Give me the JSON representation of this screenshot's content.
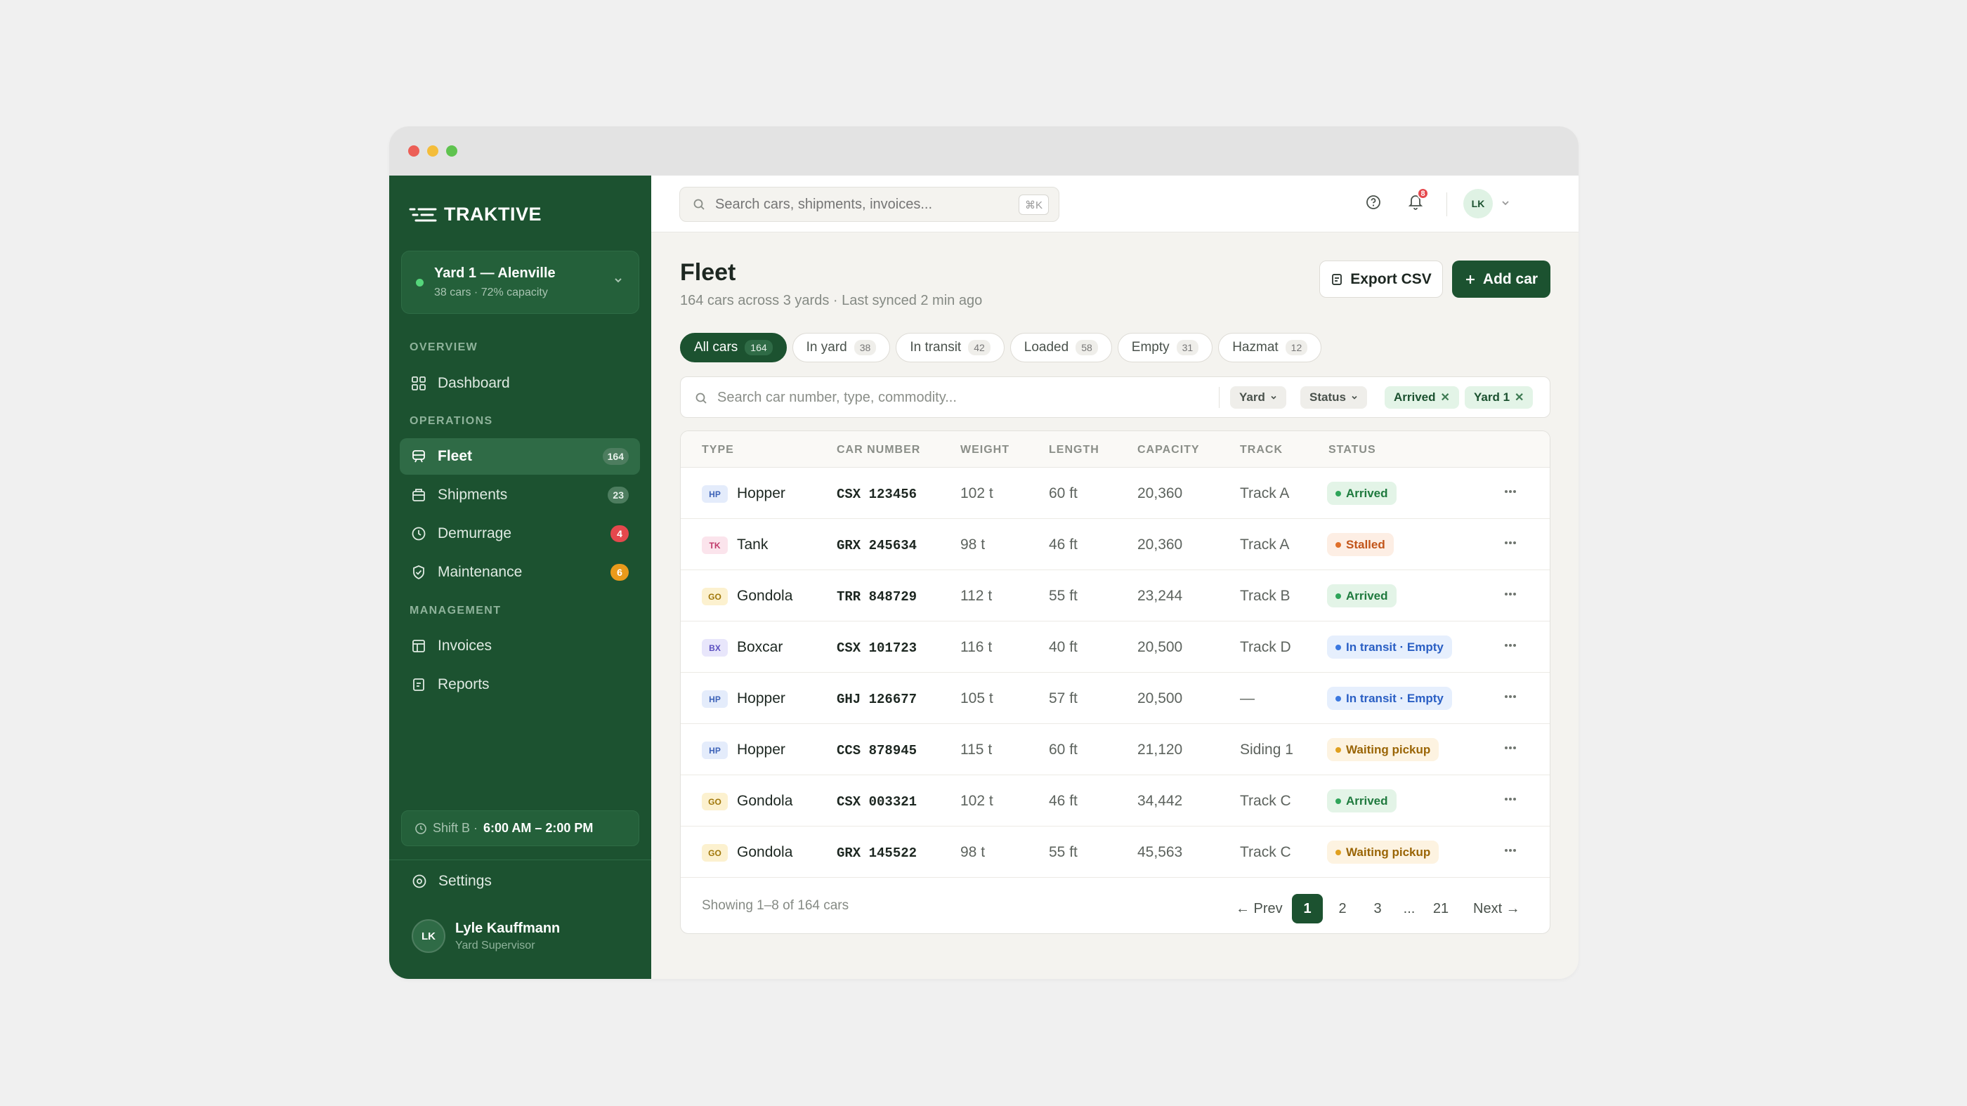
{
  "app": {
    "name": "TRAKTIVE"
  },
  "yard": {
    "name": "Yard 1 — Alenville",
    "subtitle": "38 cars · 72% capacity"
  },
  "sidebar": {
    "sections": {
      "overview": "OVERVIEW",
      "operations": "OPERATIONS",
      "management": "MANAGEMENT"
    },
    "items": [
      {
        "label": "Dashboard",
        "icon": "grid-icon"
      },
      {
        "label": "Fleet",
        "icon": "train-icon",
        "count": "164"
      },
      {
        "label": "Shipments",
        "icon": "box-icon",
        "count": "23"
      },
      {
        "label": "Demurrage",
        "icon": "clock-icon",
        "count": "4"
      },
      {
        "label": "Maintenance",
        "icon": "check-shield-icon",
        "count": "6"
      },
      {
        "label": "Invoices",
        "icon": "invoice-icon"
      },
      {
        "label": "Reports",
        "icon": "report-icon"
      }
    ],
    "shift": {
      "label": "Shift B ·",
      "time": "6:00 AM – 2:00 PM"
    },
    "settings": "Settings",
    "user": {
      "initials": "LK",
      "name": "Lyle Kauffmann",
      "role": "Yard Supervisor"
    }
  },
  "topbar": {
    "search_placeholder": "Search cars, shipments, invoices...",
    "shortcut": "⌘K",
    "notifications": "8",
    "avatar": "LK"
  },
  "page": {
    "title": "Fleet",
    "subtitle": "164 cars across 3 yards · Last synced 2 min ago",
    "export_label": "Export CSV",
    "add_label": "Add car"
  },
  "tabs": [
    {
      "label": "All cars",
      "count": "164"
    },
    {
      "label": "In yard",
      "count": "38"
    },
    {
      "label": "In transit",
      "count": "42"
    },
    {
      "label": "Loaded",
      "count": "58"
    },
    {
      "label": "Empty",
      "count": "31"
    },
    {
      "label": "Hazmat",
      "count": "12"
    }
  ],
  "filters": {
    "search_placeholder": "Search car number, type, commodity...",
    "yard": "Yard",
    "status": "Status",
    "active": [
      "Arrived",
      "Yard 1"
    ]
  },
  "table": {
    "columns": [
      "TYPE",
      "CAR NUMBER",
      "WEIGHT",
      "LENGTH",
      "CAPACITY",
      "TRACK",
      "STATUS"
    ],
    "rows": [
      {
        "code": "HP",
        "type": "Hopper",
        "car": "CSX 123456",
        "weight": "102 t",
        "length": "60 ft",
        "capacity": "20,360",
        "track": "Track A",
        "status": "Arrived"
      },
      {
        "code": "TK",
        "type": "Tank",
        "car": "GRX 245634",
        "weight": "98 t",
        "length": "46 ft",
        "capacity": "20,360",
        "track": "Track A",
        "status": "Stalled"
      },
      {
        "code": "GO",
        "type": "Gondola",
        "car": "TRR 848729",
        "weight": "112 t",
        "length": "55 ft",
        "capacity": "23,244",
        "track": "Track B",
        "status": "Arrived"
      },
      {
        "code": "BX",
        "type": "Boxcar",
        "car": "CSX 101723",
        "weight": "116 t",
        "length": "40 ft",
        "capacity": "20,500",
        "track": "Track D",
        "status": "In transit · Empty"
      },
      {
        "code": "HP",
        "type": "Hopper",
        "car": "GHJ 126677",
        "weight": "105 t",
        "length": "57 ft",
        "capacity": "20,500",
        "track": "—",
        "status": "In transit · Empty"
      },
      {
        "code": "HP",
        "type": "Hopper",
        "car": "CCS 878945",
        "weight": "115 t",
        "length": "60 ft",
        "capacity": "21,120",
        "track": "Siding 1",
        "status": "Waiting pickup"
      },
      {
        "code": "GO",
        "type": "Gondola",
        "car": "CSX 003321",
        "weight": "102 t",
        "length": "46 ft",
        "capacity": "34,442",
        "track": "Track C",
        "status": "Arrived"
      },
      {
        "code": "GO",
        "type": "Gondola",
        "car": "GRX 145522",
        "weight": "98 t",
        "length": "55 ft",
        "capacity": "45,563",
        "track": "Track C",
        "status": "Waiting pickup"
      }
    ]
  },
  "pagination": {
    "showing": "Showing 1–8 of 164 cars",
    "prev": "← Prev",
    "pages": [
      "1",
      "2",
      "3",
      "...",
      "21"
    ],
    "next": "Next →"
  },
  "colors": {
    "brand": "#1c5230",
    "badge_red": "#e5484d",
    "badge_orange": "#e99a1b"
  }
}
